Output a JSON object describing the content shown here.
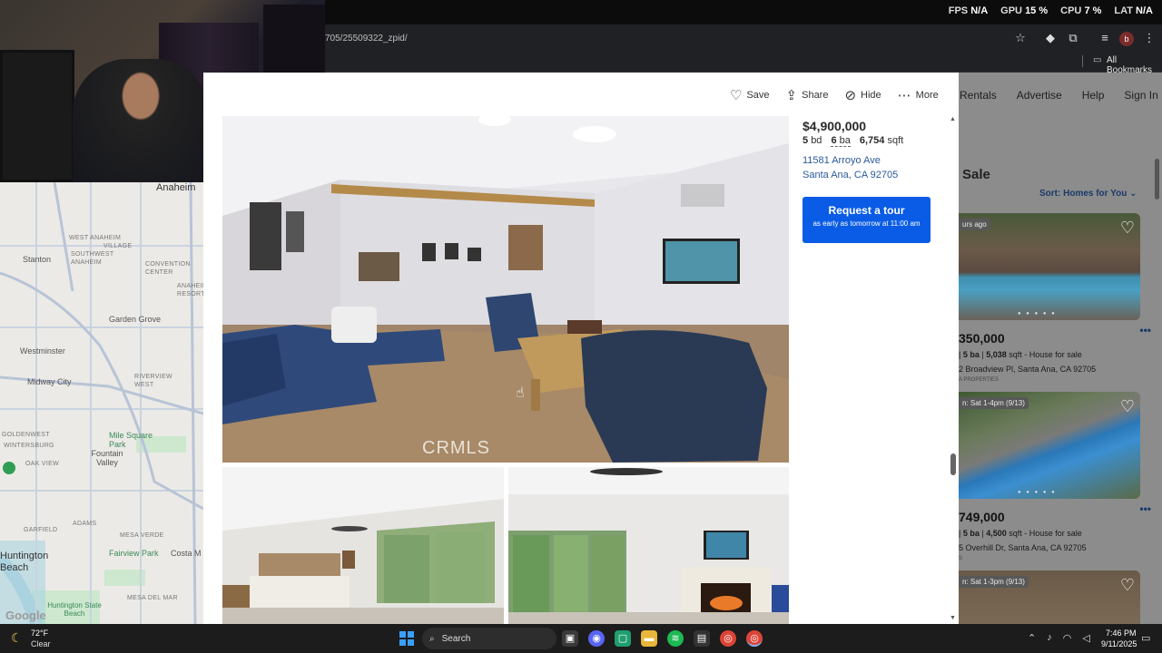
{
  "browser": {
    "url": "705/25509322_zpid/",
    "bookmarks_label": "All Bookmarks",
    "profile_initial": "b"
  },
  "overlay": {
    "fps_label": "FPS",
    "fps_value": "N/A",
    "gpu_label": "GPU",
    "gpu_value": "15 %",
    "cpu_label": "CPU",
    "cpu_value": "7 %",
    "lat_label": "LAT",
    "lat_value": "N/A"
  },
  "map": {
    "labels": {
      "anaheim": "Anaheim",
      "west_anaheim": "WEST ANAHEIM",
      "village": "VILLAGE",
      "southwest_anaheim": "SOUTHWEST ANAHEIM",
      "convention_center": "CONVENTION CENTER",
      "anaheim_resort": "ANAHEIM RESORT",
      "stanton": "Stanton",
      "garden_grove": "Garden Grove",
      "westminster": "Westminster",
      "midway_city": "Midway City",
      "riverview_west": "RIVERVIEW WEST",
      "goldenwest": "GOLDENWEST",
      "wintersburg": "WINTERSBURG",
      "mile_square_park": "Mile Square Park",
      "fountain_valley": "Fountain Valley",
      "oak_view": "OAK VIEW",
      "garfield": "GARFIELD",
      "adams": "ADAMS",
      "mesa_verde": "MESA VERDE",
      "huntington_beach": "Huntington Beach",
      "fairview_park": "Fairview Park",
      "costa_m": "Costa M",
      "mesa_del_mar": "MESA DEL MAR",
      "huntington_state_beach": "Huntington State Beach",
      "google": "Google"
    },
    "colors": {
      "road": "#c9d3e0",
      "highway": "#b8c4d6",
      "water": "#aad3df",
      "park": "#cde8cf"
    }
  },
  "listing_modal": {
    "actions": {
      "save": "Save",
      "share": "Share",
      "hide": "Hide",
      "more": "More"
    },
    "watermark": "CRMLS",
    "price": "$4,900,000",
    "beds_value": "5",
    "beds_unit": "bd",
    "baths_value": "6",
    "baths_unit": "ba",
    "sqft_value": "6,754",
    "sqft_unit": "sqft",
    "address_line1": "11581 Arroyo Ave",
    "address_line2": "Santa Ana, CA 92705",
    "tour_button": "Request a tour",
    "tour_sub": "as early as tomorrow at 11:00 am",
    "accent_color": "#0a5ce6"
  },
  "background_page": {
    "nav": [
      "Rentals",
      "Advertise",
      "Help",
      "Sign In"
    ],
    "heading": "Sale",
    "sort": "Sort: Homes for You",
    "cards": [
      {
        "tag": "urs ago",
        "price": "350,000",
        "meta_ba": "5 ba",
        "meta_sqft": "5,038",
        "meta_rest": "sqft - House for sale",
        "addr": "2 Broadview Pl, Santa Ana, CA 92705",
        "broker": "A PROPERTIES"
      },
      {
        "tag": "n: Sat 1-4pm (9/13)",
        "price": "749,000",
        "meta_ba": "5 ba",
        "meta_sqft": "4,500",
        "meta_rest": "sqft - House for sale",
        "addr": "5 Overhill Dr, Santa Ana, CA 92705",
        "broker": "S"
      },
      {
        "tag": "n: Sat 1-3pm (9/13)"
      }
    ]
  },
  "taskbar": {
    "weather_temp": "72°F",
    "weather_cond": "Clear",
    "search_label": "Search",
    "time": "7:46 PM",
    "date": "9/11/2025"
  }
}
